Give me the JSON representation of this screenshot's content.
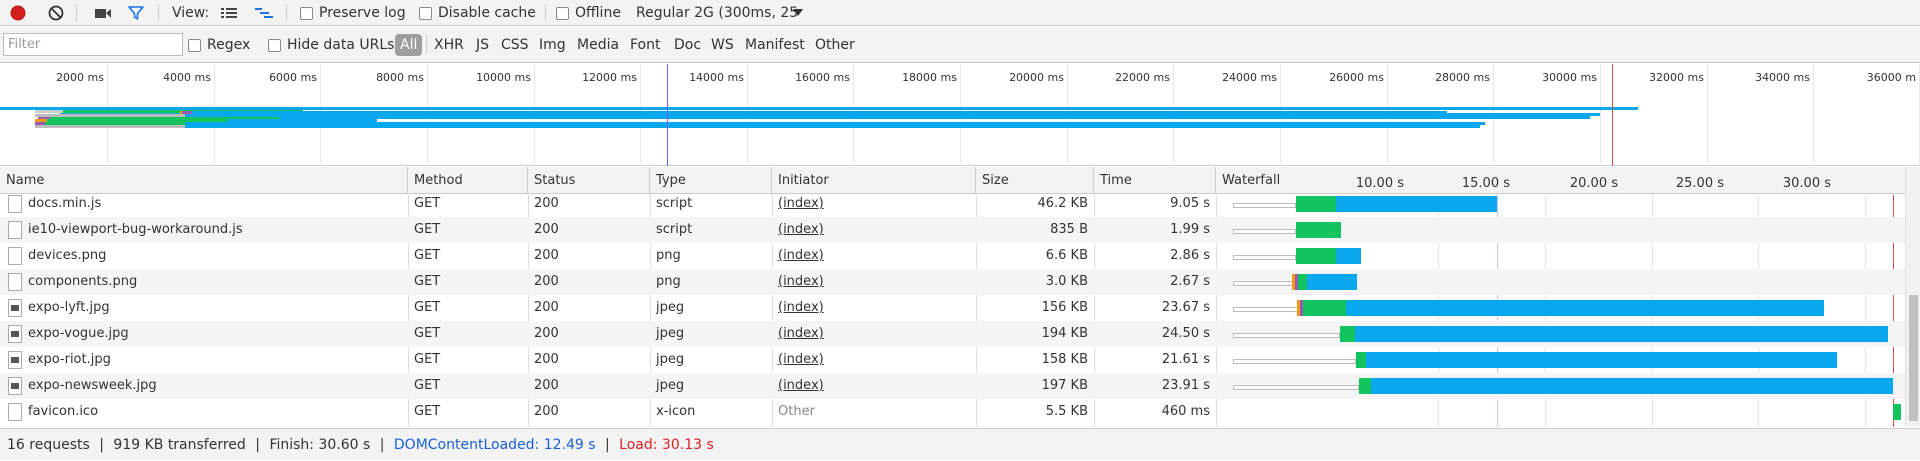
{
  "toolbar": {
    "view_label": "View:",
    "preserve_log": "Preserve log",
    "disable_cache": "Disable cache",
    "offline": "Offline",
    "throttle": "Regular 2G (300ms, 25",
    "icons": [
      "record-icon",
      "clear-icon",
      "capture-screenshots-icon",
      "filter-icon",
      "large-rows-icon",
      "overview-icon",
      "dropdown-arrow-icon"
    ]
  },
  "filterbar": {
    "placeholder": "Filter",
    "regex": "Regex",
    "hide_data_urls": "Hide data URLs",
    "types": [
      "All",
      "XHR",
      "JS",
      "CSS",
      "Img",
      "Media",
      "Font",
      "Doc",
      "WS",
      "Manifest",
      "Other"
    ]
  },
  "overview": {
    "ticks": [
      "2000 ms",
      "4000 ms",
      "6000 ms",
      "8000 ms",
      "10000 ms",
      "12000 ms",
      "14000 ms",
      "16000 ms",
      "18000 ms",
      "20000 ms",
      "22000 ms",
      "24000 ms",
      "26000 ms",
      "28000 ms",
      "30000 ms",
      "32000 ms",
      "34000 ms",
      "36000 m"
    ]
  },
  "columns": {
    "name": "Name",
    "method": "Method",
    "status": "Status",
    "type": "Type",
    "initiator": "Initiator",
    "size": "Size",
    "time": "Time",
    "waterfall": "Waterfall",
    "waterfall_ticks": [
      "10.00 s",
      "15.00 s",
      "20.00 s",
      "25.00 s",
      "30.00 s"
    ]
  },
  "rows": [
    {
      "name": "docs.min.js",
      "method": "GET",
      "status": "200",
      "type": "script",
      "initiator": "(index)",
      "size": "46.2 KB",
      "time": "9.05 s",
      "icon": "file-icon"
    },
    {
      "name": "ie10-viewport-bug-workaround.js",
      "method": "GET",
      "status": "200",
      "type": "script",
      "initiator": "(index)",
      "size": "835 B",
      "time": "1.99 s",
      "icon": "file-icon"
    },
    {
      "name": "devices.png",
      "method": "GET",
      "status": "200",
      "type": "png",
      "initiator": "(index)",
      "size": "6.6 KB",
      "time": "2.86 s",
      "icon": "file-icon"
    },
    {
      "name": "components.png",
      "method": "GET",
      "status": "200",
      "type": "png",
      "initiator": "(index)",
      "size": "3.0 KB",
      "time": "2.67 s",
      "icon": "file-icon"
    },
    {
      "name": "expo-lyft.jpg",
      "method": "GET",
      "status": "200",
      "type": "jpeg",
      "initiator": "(index)",
      "size": "156 KB",
      "time": "23.67 s",
      "icon": "image-thumbnail-icon"
    },
    {
      "name": "expo-vogue.jpg",
      "method": "GET",
      "status": "200",
      "type": "jpeg",
      "initiator": "(index)",
      "size": "194 KB",
      "time": "24.50 s",
      "icon": "image-thumbnail-icon"
    },
    {
      "name": "expo-riot.jpg",
      "method": "GET",
      "status": "200",
      "type": "jpeg",
      "initiator": "(index)",
      "size": "158 KB",
      "time": "21.61 s",
      "icon": "image-thumbnail-icon"
    },
    {
      "name": "expo-newsweek.jpg",
      "method": "GET",
      "status": "200",
      "type": "jpeg",
      "initiator": "(index)",
      "size": "197 KB",
      "time": "23.91 s",
      "icon": "image-thumbnail-icon"
    },
    {
      "name": "favicon.ico",
      "method": "GET",
      "status": "200",
      "type": "x-icon",
      "initiator": "Other",
      "size": "5.5 KB",
      "time": "460 ms",
      "icon": "file-icon"
    }
  ],
  "status": {
    "requests": "16 requests",
    "transferred": "919 KB transferred",
    "finish": "Finish: 30.60 s",
    "dom_content_loaded": "DOMContentLoaded: 12.49 s",
    "load": "Load: 30.13 s",
    "separator": "|"
  },
  "colors": {
    "waiting": "#12c45e",
    "download": "#08a7ee",
    "dom_line": "#6a6ae8",
    "load_line": "#e34c4c"
  }
}
